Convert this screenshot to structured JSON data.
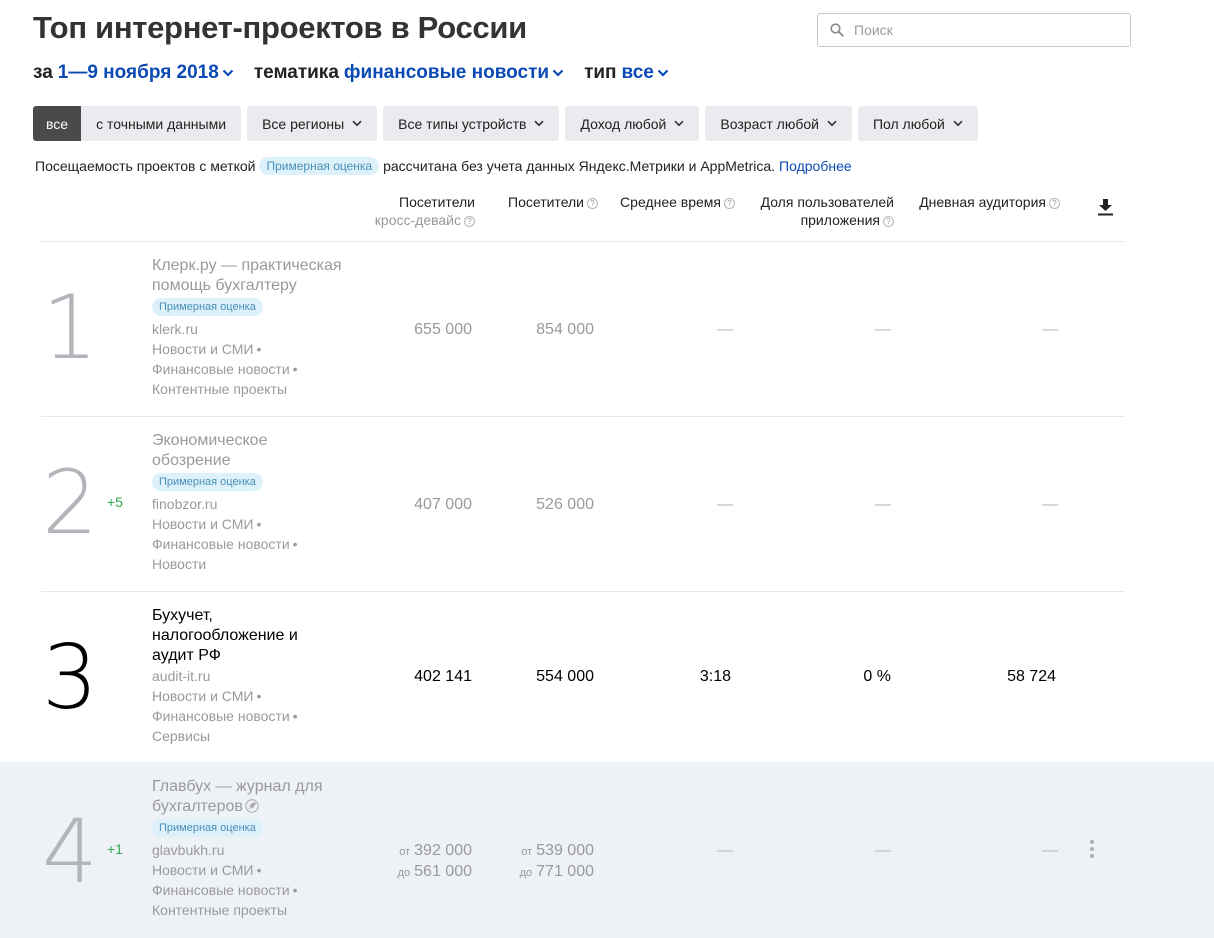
{
  "header": {
    "title": "Топ интернет-проектов в России",
    "search_placeholder": "Поиск"
  },
  "params": {
    "period_label": "за",
    "period_value": "1—9 ноября 2018",
    "topic_label": "тематика",
    "topic_value": "финансовые новости",
    "type_label": "тип",
    "type_value": "все"
  },
  "filters": {
    "all": "все",
    "exact": "с точными данными",
    "regions": "Все регионы",
    "devices": "Все типы устройств",
    "income": "Доход любой",
    "age": "Возраст любой",
    "gender": "Пол любой"
  },
  "note": {
    "text_before": "Посещаемость проектов с меткой",
    "tag": "Примерная оценка",
    "text_after": "рассчитана без учета данных Яндекс.Метрики и AppMetrica.",
    "link": "Подробнее"
  },
  "columns": {
    "visitors_cross_line1": "Посетители",
    "visitors_cross_line2": "кросс-девайс",
    "visitors": "Посетители",
    "avg_time": "Среднее время",
    "app_share_line1": "Доля пользователей",
    "app_share_line2": "приложения",
    "daily": "Дневная аудитория"
  },
  "rows": [
    {
      "rank": "1",
      "delta": "",
      "name_line1": "Клерк.ру — практическая",
      "name_line2": "помощь бухгалтеру",
      "tag": "Примерная оценка",
      "domain": "klerk.ru",
      "cat1": "Новости и СМИ",
      "cat2": "Финансовые новости",
      "cat3": "Контентные проекты",
      "visitors_cross": "655 000",
      "visitors": "854 000",
      "avg_time": "—",
      "app_share": "—",
      "daily": "—"
    },
    {
      "rank": "2",
      "delta": "+5",
      "name_line1": "Экономическое",
      "name_line2": "обозрение",
      "tag": "Примерная оценка",
      "domain": "finobzor.ru",
      "cat1": "Новости и СМИ",
      "cat2": "Финансовые новости",
      "cat3": "Новости",
      "visitors_cross": "407 000",
      "visitors": "526 000",
      "avg_time": "—",
      "app_share": "—",
      "daily": "—"
    },
    {
      "rank": "3",
      "delta": "",
      "name_line1": "Бухучет,",
      "name_line2": "налогообложение и",
      "name_line3": "аудит РФ",
      "domain": "audit-it.ru",
      "cat1": "Новости и СМИ",
      "cat2": "Финансовые новости",
      "cat3": "Сервисы",
      "visitors_cross": "402 141",
      "visitors": "554 000",
      "avg_time": "3:18",
      "app_share": "0 %",
      "daily": "58 724"
    },
    {
      "rank": "4",
      "delta": "+1",
      "name_line1": "Главбух — журнал для",
      "name_line2": "бухгалтеров",
      "tag": "Примерная оценка",
      "domain": "glavbukh.ru",
      "cat1": "Новости и СМИ",
      "cat2": "Финансовые новости",
      "cat3": "Контентные проекты",
      "from_label": "от",
      "to_label": "до",
      "visitors_cross_from": "392 000",
      "visitors_cross_to": "561 000",
      "visitors_from": "539 000",
      "visitors_to": "771 000",
      "avg_time": "—",
      "app_share": "—",
      "daily": "—"
    }
  ],
  "colors": {
    "link": "#0b4ab5",
    "tag_bg": "#ddf1fb",
    "tag_text": "#4a8fb7",
    "delta": "#2fa84f",
    "highlight_row": "#eef1f5"
  }
}
